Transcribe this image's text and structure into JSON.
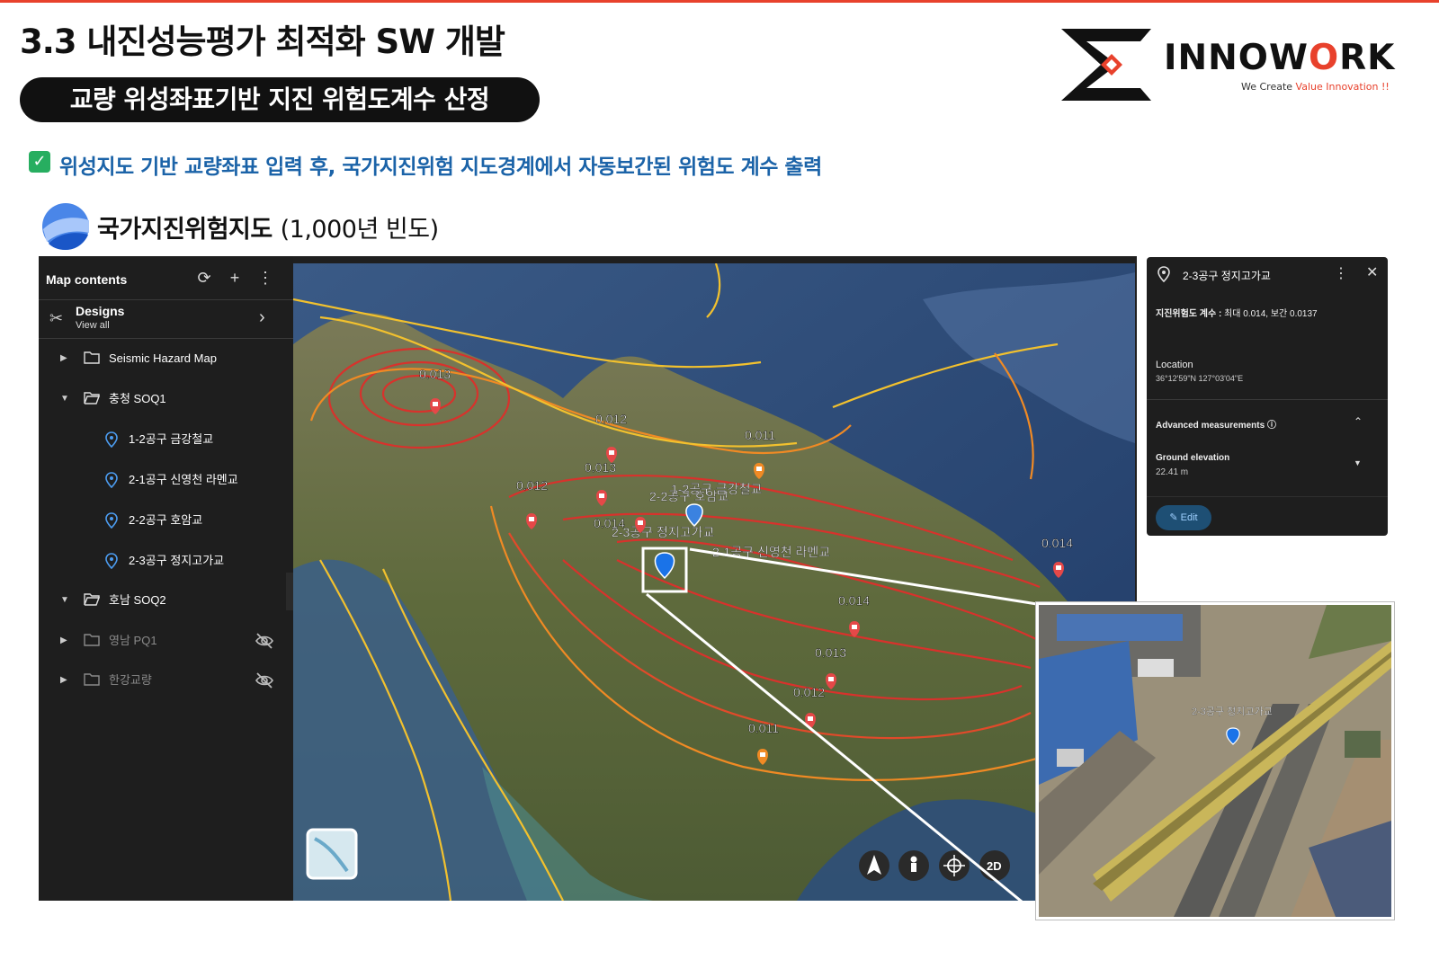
{
  "slide": {
    "title": "3.3  내진성능평가 최적화 SW 개발",
    "pill": "교량 위성좌표기반 지진 위험도계수 산정",
    "headline": "위성지도 기반 교량좌표 입력 후, 국가지진위험 지도경계에서 자동보간된 위험도 계수 출력",
    "map_title": "국가지진위험지도",
    "map_subtitle": "(1,000년 빈도)",
    "check_glyph": "✓"
  },
  "logo": {
    "word_a": "IN",
    "word_b": "NOW",
    "word_o": "O",
    "word_c": "RK",
    "tagline_a": "We Create ",
    "tagline_b": "Value Innovation !!"
  },
  "sidebar": {
    "title": "Map contents",
    "designs_label": "Designs",
    "designs_sub": "View all",
    "items": [
      {
        "label": "Seismic Hazard Map"
      },
      {
        "label": "충청 SOQ1"
      },
      {
        "label": "1-2공구 금강철교"
      },
      {
        "label": "2-1공구 신영천 라멘교"
      },
      {
        "label": "2-2공구 호암교"
      },
      {
        "label": "2-3공구 정지고가교"
      },
      {
        "label": "호남 SOQ2"
      },
      {
        "label": "영남 PQ1"
      },
      {
        "label": "한강교량"
      }
    ]
  },
  "map": {
    "contour_labels": [
      "0.013",
      "0.012",
      "0.011",
      "0.013",
      "0.012",
      "0.014",
      "0.014",
      "0.014",
      "0.013",
      "0.012",
      "0.011"
    ],
    "place_labels": [
      "2-2공구 호암교",
      "1-2공구 금강철교",
      "2-3공구 정지고가교",
      "2-1공구 신영천 라멘교"
    ],
    "nav_labels": {
      "mode_2d": "2D"
    },
    "colors": {
      "contour_red": "#d8322c",
      "contour_orange": "#f08a24",
      "contour_yellow": "#f2c12e",
      "water": "#2e4d78",
      "land": "#6f6a44"
    }
  },
  "info": {
    "name": "2-3공구 정지고가교",
    "coef_label": "지진위험도 계수 :",
    "coef_value": "최대 0.014, 보간 0.0137",
    "location_label": "Location",
    "location_value": "36°12'59\"N 127°03'04\"E",
    "advanced_label": "Advanced measurements",
    "elevation_label": "Ground elevation",
    "elevation_value": "22.41 m",
    "edit_label": "Edit"
  },
  "inset": {
    "label": "2-3공구 정지고가교"
  }
}
